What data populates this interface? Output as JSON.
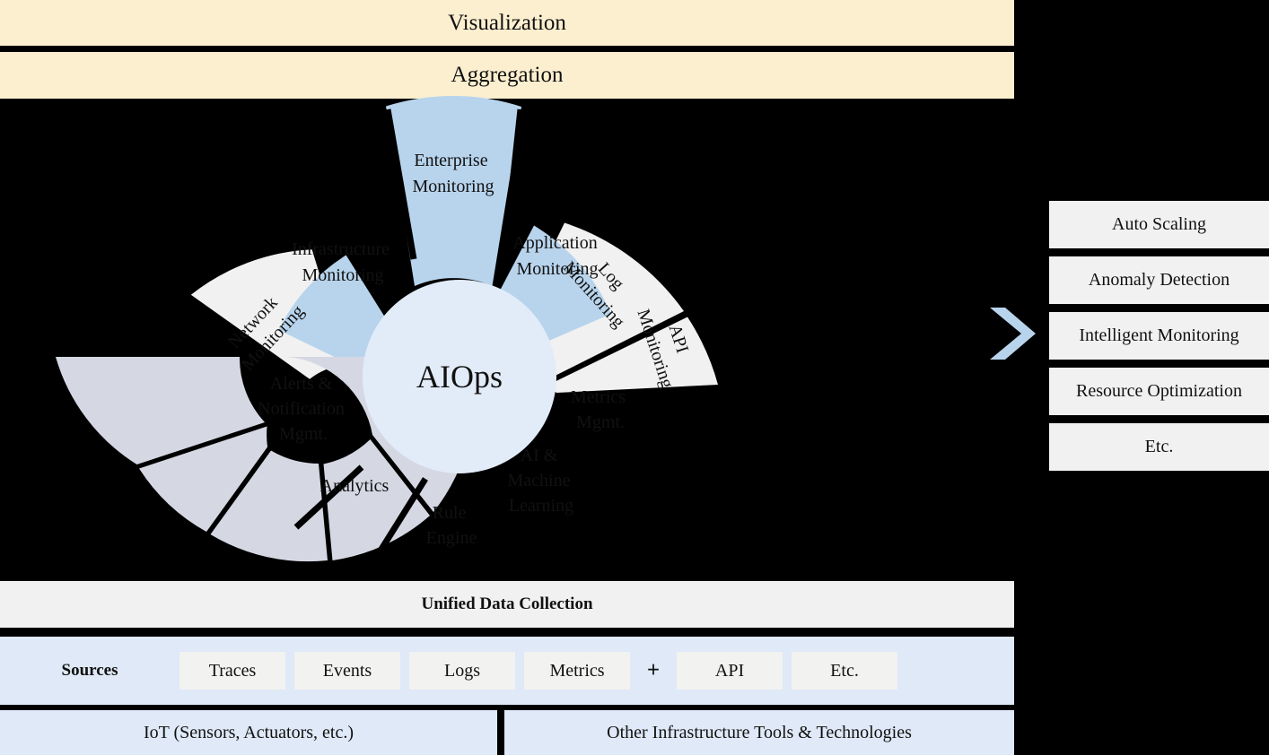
{
  "header": {
    "visualization": "Visualization",
    "aggregation": "Aggregation"
  },
  "wheel": {
    "center_label": "AIOps",
    "outer_ring": [
      {
        "label_line1": "Network",
        "label_line2": "Monitoring"
      },
      {
        "label_line1": "Log",
        "label_line2": "Monitoring"
      },
      {
        "label_line1": "API",
        "label_line2": "Monitoring"
      }
    ],
    "inner_ring_top": [
      {
        "label_line1": "Infrastructure",
        "label_line2": "Monitoring"
      },
      {
        "label_line1": "Enterprise",
        "label_line2": "Monitoring"
      },
      {
        "label_line1": "Application",
        "label_line2": "Monitoring"
      }
    ],
    "ring_bottom": [
      {
        "label_line1": "Alerts &",
        "label_line2": "Notification",
        "label_line3": "Mgmt."
      },
      {
        "label_line1": "Analytics",
        "label_line2": "",
        "label_line3": ""
      },
      {
        "label_line1": "Rule",
        "label_line2": "Engine",
        "label_line3": ""
      },
      {
        "label_line1": "AI  &",
        "label_line2": "Machine",
        "label_line3": "Learning"
      },
      {
        "label_line1": "Metrics",
        "label_line2": "Mgmt.",
        "label_line3": ""
      }
    ]
  },
  "outcomes": [
    "Auto Scaling",
    "Anomaly Detection",
    "Intelligent Monitoring",
    "Resource Optimization",
    "Etc."
  ],
  "unified_data_collection": "Unified Data Collection",
  "sources": {
    "label": "Sources",
    "items_left": [
      "Traces",
      "Events",
      "Logs",
      "Metrics"
    ],
    "separator": "+",
    "items_right": [
      "API",
      "Etc."
    ]
  },
  "bottom": {
    "iot": "IoT (Sensors, Actuators, etc.)",
    "other": "Other Infrastructure Tools & Technologies"
  },
  "colors": {
    "banner_bg": "#fcefcf",
    "panel_bg": "#f1f1f1",
    "sources_bg": "#dfe9f7",
    "wheel_blue": "#b8d4ec",
    "wheel_white": "#f1f1f1",
    "wheel_gray": "#d5d8e3",
    "wheel_center": "#e2ecf8",
    "arrow": "#b8d4ec",
    "background": "#000000"
  }
}
